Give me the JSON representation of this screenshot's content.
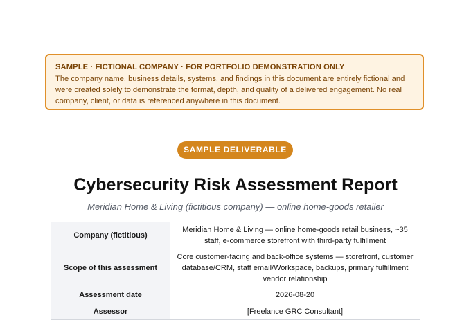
{
  "notice": {
    "title": "SAMPLE · FICTIONAL COMPANY · FOR PORTFOLIO DEMONSTRATION ONLY",
    "body": "The company name, business details, systems, and findings in this document are entirely fictional and were created solely to demonstrate the format, depth, and quality of a delivered engagement. No real company, client, or data is referenced anywhere in this document."
  },
  "badge": "SAMPLE DELIVERABLE",
  "report": {
    "title": "Cybersecurity Risk Assessment Report",
    "subtitle": "Meridian Home & Living (fictitious company) — online home-goods retailer"
  },
  "details": [
    {
      "label": "Company (fictitious)",
      "value": "Meridian Home & Living — online home-goods retail business, ~35 staff, e-commerce storefront with third-party fulfillment"
    },
    {
      "label": "Scope of this assessment",
      "value": "Core customer-facing and back-office systems — storefront, customer database/CRM, staff email/Workspace, backups, primary fulfillment vendor relationship"
    },
    {
      "label": "Assessment date",
      "value": "2026-08-20"
    },
    {
      "label": "Assessor",
      "value": "[Freelance GRC Consultant]"
    }
  ],
  "colors": {
    "notice_border": "#e0902a",
    "notice_background": "#fef3e2",
    "notice_text": "#7a4406",
    "badge_background": "#d4861d",
    "label_cell_background": "#f3f4f7"
  }
}
